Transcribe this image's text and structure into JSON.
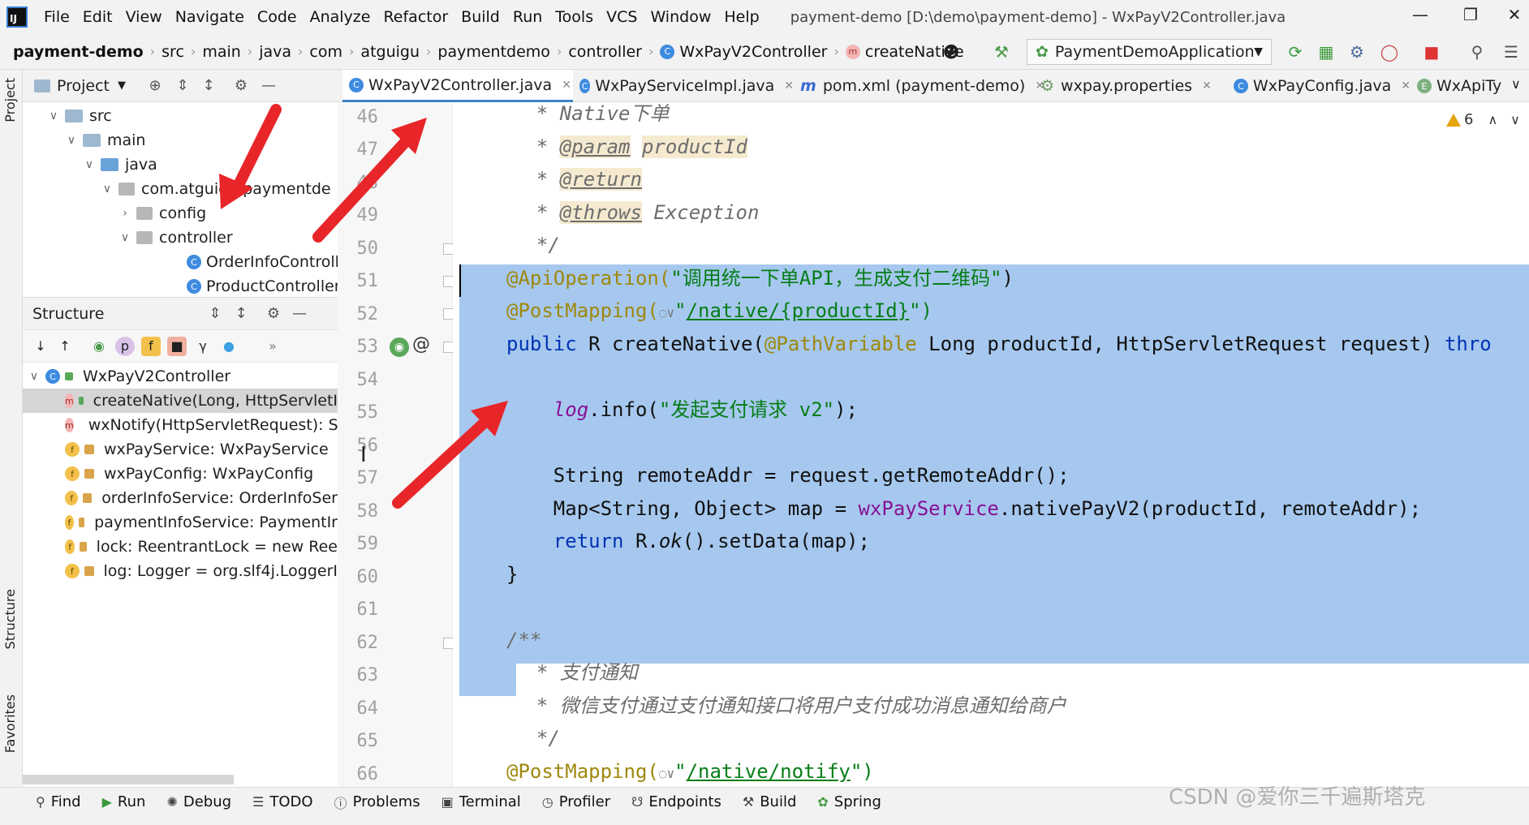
{
  "menubar": {
    "items": [
      "File",
      "Edit",
      "View",
      "Navigate",
      "Code",
      "Analyze",
      "Refactor",
      "Build",
      "Run",
      "Tools",
      "VCS",
      "Window",
      "Help"
    ],
    "window_title": "payment-demo [D:\\demo\\payment-demo] - WxPayV2Controller.java"
  },
  "breadcrumb": {
    "project": "payment-demo",
    "parts": [
      "src",
      "main",
      "java",
      "com",
      "atguigu",
      "paymentdemo",
      "controller"
    ],
    "class": "WxPayV2Controller",
    "method": "createNative"
  },
  "toolbar": {
    "run_config": "PaymentDemoApplication"
  },
  "side_tabs": {
    "project": "Project",
    "structure": "Structure",
    "favorites": "Favorites"
  },
  "project_panel": {
    "title": "Project",
    "tree": [
      "src",
      "main",
      "java",
      "com.atguigu.paymentde",
      "config",
      "controller",
      "OrderInfoControll",
      "ProductController"
    ]
  },
  "structure_panel": {
    "title": "Structure",
    "root": "WxPayV2Controller",
    "members": [
      "createNative(Long, HttpServletI",
      "wxNotify(HttpServletRequest): S",
      "wxPayService: WxPayService",
      "wxPayConfig: WxPayConfig",
      "orderInfoService: OrderInfoSer",
      "paymentInfoService: PaymentIr",
      "lock: ReentrantLock = new Ree",
      "log: Logger = org.slf4j.LoggerI"
    ]
  },
  "editor_tabs": [
    "WxPayV2Controller.java",
    "WxPayServiceImpl.java",
    "pom.xml (payment-demo)",
    "wxpay.properties",
    "WxPayConfig.java",
    "WxApiTy"
  ],
  "warnings": {
    "count": "6"
  },
  "editor": {
    "line_numbers": [
      "46",
      "47",
      "48",
      "49",
      "50",
      "51",
      "52",
      "53",
      "54",
      "55",
      "56",
      "57",
      "58",
      "59",
      "60",
      "61",
      "62",
      "63",
      "64",
      "65",
      "66"
    ],
    "code": {
      "l46a": "  * ",
      "l46b": "Native下单",
      "l47a": "  * ",
      "l47b": "@param",
      "l47c": " ",
      "l47d": "productId",
      "l48a": "  * ",
      "l48b": "@return",
      "l49a": "  * ",
      "l49b": "@throws",
      "l49c": " Exception",
      "l50": "  */",
      "l51a": "@ApiOperation(",
      "l51b": "\"调用统一下单API，生成支付二维码\"",
      "l51c": ")",
      "l52a": "@PostMapping(",
      "l52b": "◌∨",
      "l52c": "\"",
      "l52d": "/native/{productId}",
      "l52e": "\")",
      "l53a": "public",
      "l53b": " R createNative(",
      "l53c": "@PathVariable",
      "l53d": " Long productId, HttpServletRequest request) ",
      "l53e": "thro",
      "l55a": "    ",
      "l55b": "log",
      "l55c": ".info(",
      "l55d": "\"发起支付请求 v2\"",
      "l55e": ");",
      "l57": "    String remoteAddr = request.getRemoteAddr();",
      "l58a": "    Map<String, Object> map = ",
      "l58b": "wxPayService",
      "l58c": ".nativePayV2(productId, remoteAddr);",
      "l59a": "    ",
      "l59b": "return",
      "l59c": " R.",
      "l59d": "ok",
      "l59e": "().setData(map);",
      "l60": "}",
      "l62": "/**",
      "l63a": "  * ",
      "l63b": "支付通知",
      "l64a": "  * ",
      "l64b": "微信支付通过支付通知接口将用户支付成功消息通知给商户",
      "l65": "  */",
      "l66a": "@PostMapping(",
      "l66b": "◌∨",
      "l66c": "\"",
      "l66d": "/native/notify",
      "l66e": "\")"
    }
  },
  "bottom_tools": [
    "Find",
    "Run",
    "Debug",
    "TODO",
    "Problems",
    "Terminal",
    "Profiler",
    "Endpoints",
    "Build",
    "Spring"
  ],
  "watermark": "CSDN @爱你三千遍斯塔克",
  "colors": {
    "selection": "#a6c8ef",
    "active_tab": "#4083c9",
    "annotation_arrow": "#e8262a"
  }
}
